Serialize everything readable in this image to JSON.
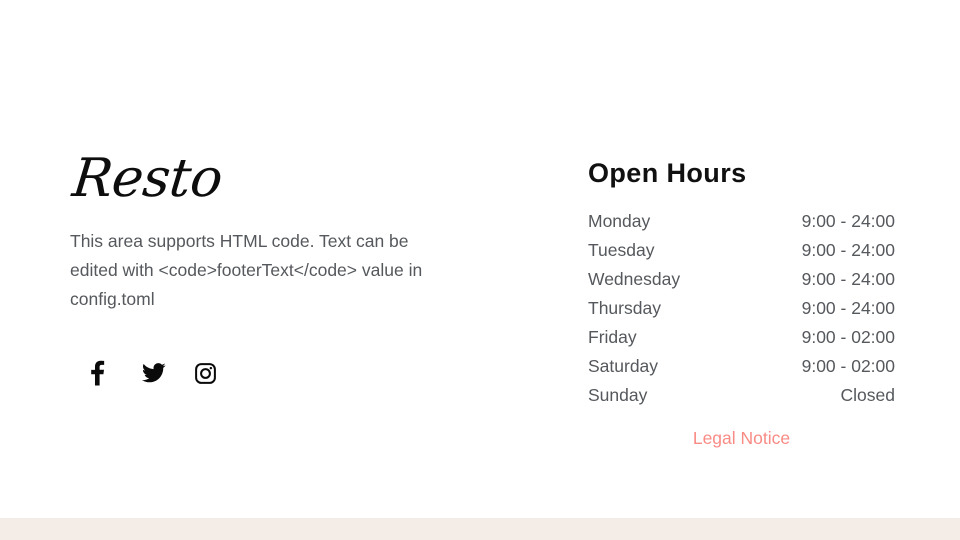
{
  "theme": {
    "page_background": "#ffffff",
    "band_background": "#f3ece7",
    "body_text_color": "#55585c",
    "heading_color": "#101010",
    "link_color": "#f98b85"
  },
  "brand": {
    "logo_text": "Resto",
    "footer_text": "This area supports HTML code. Text can be edited with <code>footerText</code> value in config.toml",
    "social": [
      {
        "name": "facebook",
        "icon": "facebook-icon",
        "label": "Facebook"
      },
      {
        "name": "twitter",
        "icon": "twitter-icon",
        "label": "Twitter"
      },
      {
        "name": "instagram",
        "icon": "instagram-icon",
        "label": "Instagram"
      }
    ]
  },
  "hours": {
    "title": "Open Hours",
    "rows": [
      {
        "day": "Monday",
        "time": "9:00 - 24:00"
      },
      {
        "day": "Tuesday",
        "time": "9:00 - 24:00"
      },
      {
        "day": "Wednesday",
        "time": "9:00 - 24:00"
      },
      {
        "day": "Thursday",
        "time": "9:00 - 24:00"
      },
      {
        "day": "Friday",
        "time": "9:00 - 02:00"
      },
      {
        "day": "Saturday",
        "time": "9:00 - 02:00"
      },
      {
        "day": "Sunday",
        "time": "Closed"
      }
    ],
    "legal_link": "Legal Notice"
  }
}
